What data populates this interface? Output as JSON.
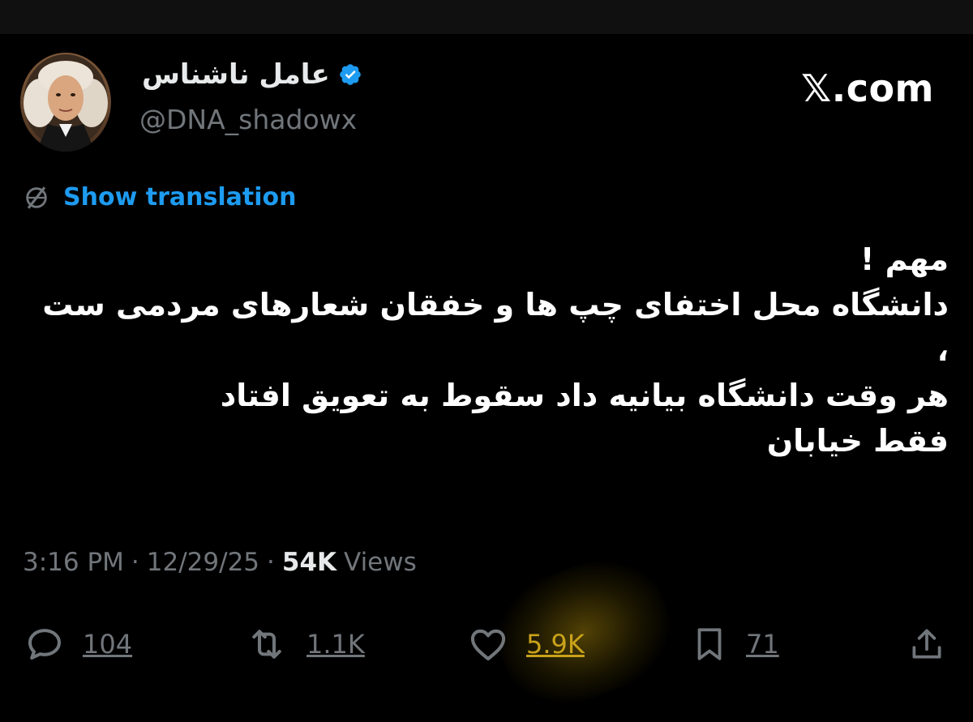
{
  "profile": {
    "display_name": "عامل ناشناس",
    "handle": "@DNA_shadowx",
    "verified": true
  },
  "brand": "𝕏.com",
  "translate": {
    "label": "Show translation",
    "icon": "globe-slash-icon"
  },
  "tweet": {
    "text": "مهم !\nدانشگاه محل اختفای چپ ها و خفقان شعارهای مردمی ست ،\nهر وقت دانشگاه بیانیه داد سقوط به تعویق افتاد\nفقط خیابان"
  },
  "meta": {
    "time": "3:16 PM",
    "date": "12/29/25",
    "views_count": "54K",
    "views_label": "Views"
  },
  "actions": {
    "replies": "104",
    "reposts": "1.1K",
    "likes": "5.9K",
    "bookmarks": "71"
  },
  "colors": {
    "background": "#000000",
    "text": "#e7e9ea",
    "muted": "#71767b",
    "link": "#1d9bf0",
    "highlight": "#c9a21a"
  }
}
